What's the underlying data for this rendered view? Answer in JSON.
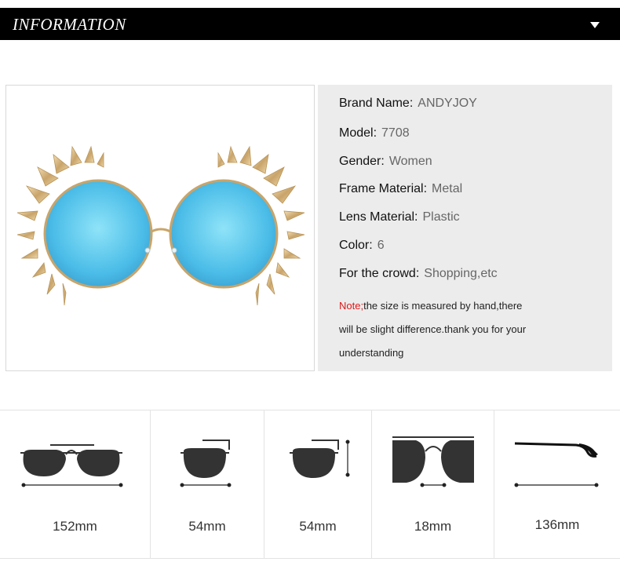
{
  "header": {
    "title": "INFORMATION",
    "toggle_icon": "triangle-down-icon"
  },
  "product_image": {
    "description_icon": "sunglasses-icon",
    "lens_color": "#5ac8ee",
    "frame_color": "#d9b882"
  },
  "specs": [
    {
      "label": "Brand Name:",
      "value": "ANDYJOY"
    },
    {
      "label": "Model:",
      "value": "7708"
    },
    {
      "label": "Gender:",
      "value": "Women"
    },
    {
      "label": "Frame Material:",
      "value": "Metal"
    },
    {
      "label": "Lens Material:",
      "value": "Plastic"
    },
    {
      "label": "Color:",
      "value": "6"
    },
    {
      "label": "For the crowd:",
      "value": "Shopping,etc"
    }
  ],
  "note": {
    "prefix": "Note;",
    "line1": "the size is measured by hand,there",
    "line2": "will be slight difference.thank you for your",
    "line3": "understanding"
  },
  "measurements": [
    {
      "label": "152mm",
      "icon": "frame-width-icon"
    },
    {
      "label": "54mm",
      "icon": "lens-width-icon"
    },
    {
      "label": "54mm",
      "icon": "lens-height-icon"
    },
    {
      "label": "18mm",
      "icon": "bridge-width-icon"
    },
    {
      "label": "136mm",
      "icon": "temple-length-icon"
    }
  ]
}
